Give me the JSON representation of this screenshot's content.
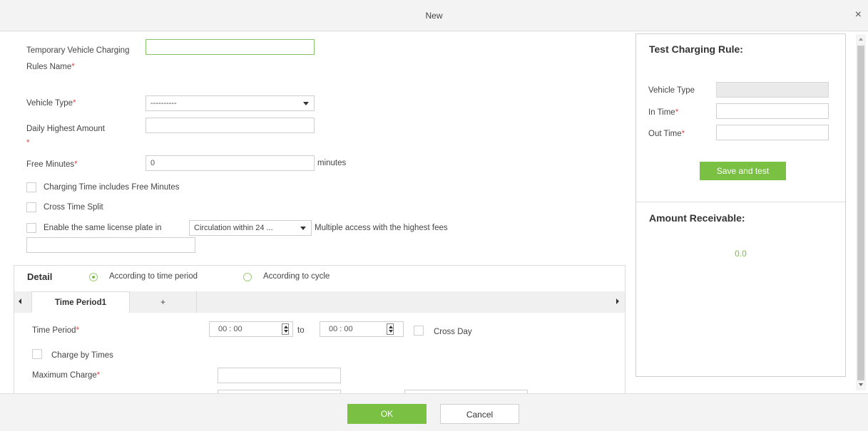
{
  "dialog": {
    "title": "New",
    "close_glyph": "×"
  },
  "form": {
    "rule_name_label": "Temporary Vehicle Charging Rules Name",
    "rule_name_value": "",
    "vehicle_type_label": "Vehicle Type",
    "vehicle_type_value": "----------",
    "daily_highest_label": "Daily Highest Amount",
    "daily_highest_value": "",
    "free_minutes_label": "Free Minutes",
    "free_minutes_value": "0",
    "free_minutes_unit": "minutes",
    "charging_includes_free_label": "Charging Time includes Free Minutes",
    "cross_time_split_label": "Cross Time Split",
    "same_plate_label": "Enable the same license plate in",
    "circulation_select_value": "Circulation within 24 ...",
    "multiple_access_label": "Multiple access with the highest fees",
    "extra_value": "",
    "required_mark": "*"
  },
  "detail": {
    "title": "Detail",
    "option_time_period": "According to time period",
    "option_cycle": "According to cycle",
    "tab_active": "Time Period1",
    "tab_add": "+",
    "time_period_label": "Time Period",
    "time_from": "00 : 00",
    "time_to": "00 : 00",
    "to_label": "to",
    "cross_day_label": "Cross Day",
    "charge_by_times_label": "Charge by Times",
    "maximum_charge_label": "Maximum Charge",
    "maximum_charge_value": ""
  },
  "test_panel": {
    "title": "Test Charging Rule:",
    "vehicle_type_label": "Vehicle Type",
    "in_time_label": "In Time",
    "out_time_label": "Out Time",
    "save_test_label": "Save and test",
    "amount_title": "Amount Receivable:",
    "amount_value": "0.0"
  },
  "footer": {
    "ok_label": "OK",
    "cancel_label": "Cancel"
  },
  "colors": {
    "accent": "#7ac143",
    "required": "#e14b4b"
  }
}
